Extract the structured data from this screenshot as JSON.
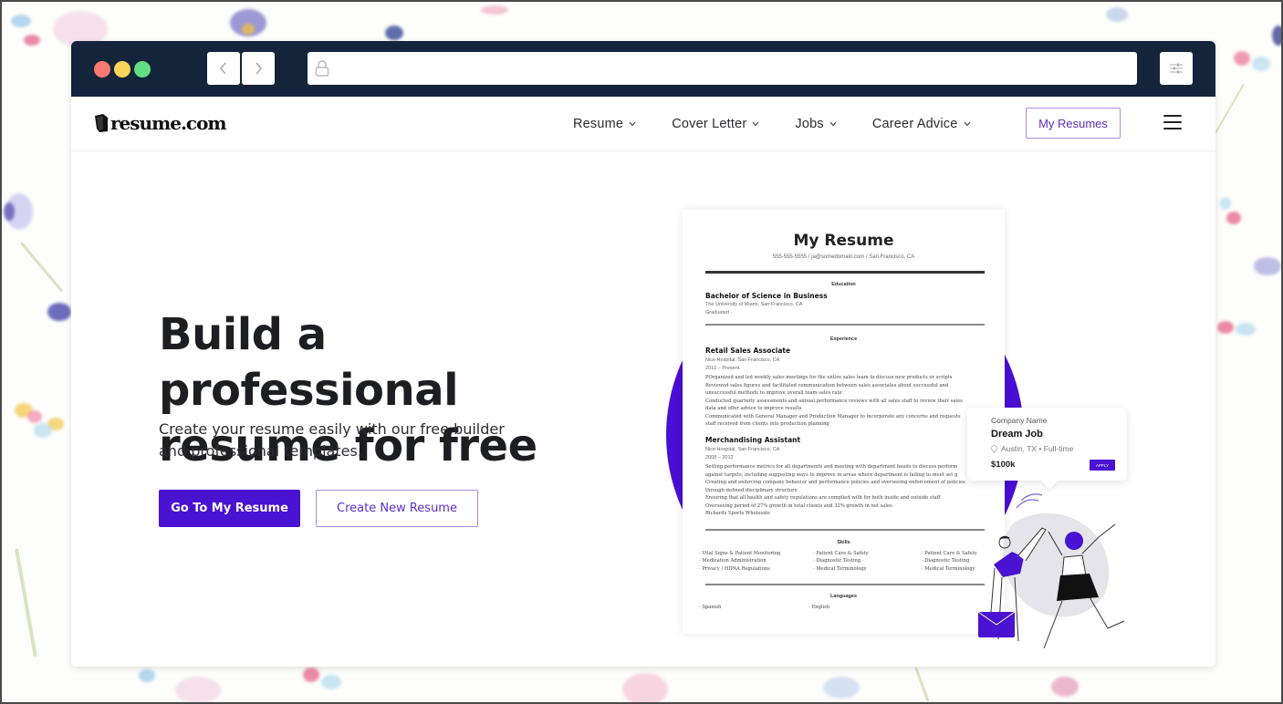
{
  "browser": {
    "url": "",
    "back_icon": "chevron-left-icon",
    "forward_icon": "chevron-right-icon",
    "lock_icon": "lock-icon",
    "settings_icon": "sliders-icon"
  },
  "site": {
    "logo_text": "resume.com",
    "nav": [
      {
        "label": "Resume"
      },
      {
        "label": "Cover Letter"
      },
      {
        "label": "Jobs"
      },
      {
        "label": "Career Advice"
      }
    ],
    "my_resumes_label": "My Resumes",
    "menu_icon": "hamburger-icon"
  },
  "hero": {
    "title_line1": "Build a professional",
    "title_line2": "resume for free",
    "subtitle_line1": "Create your resume easily with our free builder",
    "subtitle_line2": "and professional templates.",
    "primary_button": "Go To My Resume",
    "secondary_button": "Create New Resume"
  },
  "resume_preview": {
    "title": "My Resume",
    "contact": "555-555-5555 / ja@somedomain.com / San Francisco, CA",
    "education": {
      "heading": "Education",
      "degree": "Bachelor of Science in Business",
      "school": "The University of Miami, San Francisco, CA",
      "graduated": "Graduated -"
    },
    "experience": {
      "heading": "Experience",
      "jobs": [
        {
          "title": "Retail Sales Associate",
          "location": "Nice Hospital, San Francisco, CA",
          "dates": "2012 – Present",
          "lines": [
            "POrganized and led weekly sales meetings for the entire sales team to discuss new products or scripts",
            "Reviewed sales figures and facilitated communication between sales associates about successful and",
            "unsuccessful methods to improve overall team sales rate",
            "Conducted quarterly assessments and annual performance reviews with all sales staff to review their sales",
            "data and offer advice to improve results",
            "Communicated with General Manager and Production Manager to incorporate any concerns and requests",
            "staff received from clients into production planning"
          ]
        },
        {
          "title": "Merchandising Assistant",
          "location": "Nice Hospital, San Francisco, CA",
          "dates": "2008 – 2012",
          "lines": [
            "Setting performance metrics for all departments and meeting with department heads to discuss perform",
            "against targets, including suggesting ways to improve in areas where department is failing to meet set g",
            "Creating and enforcing company behavior and performance policies and overseeing enforcement of policies",
            "through defined disciplinary structure",
            "Ensuring that all health and safety regulations are complied with for both inside and outside staff",
            "Overseeing period of 27% growth in total clients and 32% growth in net sales",
            "Richards Sports Wholesale"
          ]
        }
      ]
    },
    "skills": {
      "heading": "Skills",
      "columns": [
        [
          "Vital Signs & Patient Monitoring",
          "Medication Administration",
          "Privacy / HIPAA Regulations"
        ],
        [
          "Patient Care & Safety",
          "Diagnostic Testing",
          "Medical Terminology"
        ],
        [
          "Patient Care & Safety",
          "Diagnostic Testing",
          "Medical Terminology"
        ]
      ]
    },
    "languages": {
      "heading": "Languages",
      "items": [
        "Spanish",
        "English"
      ]
    }
  },
  "job_card": {
    "company": "Company Name",
    "title": "Dream Job",
    "location": "Austin, TX • Full-time",
    "salary": "$100k",
    "apply_label": "APPLY"
  },
  "colors": {
    "brand_purple": "#4a12d1",
    "chrome_navy": "#13243b",
    "outline_purple": "#a88be0"
  }
}
